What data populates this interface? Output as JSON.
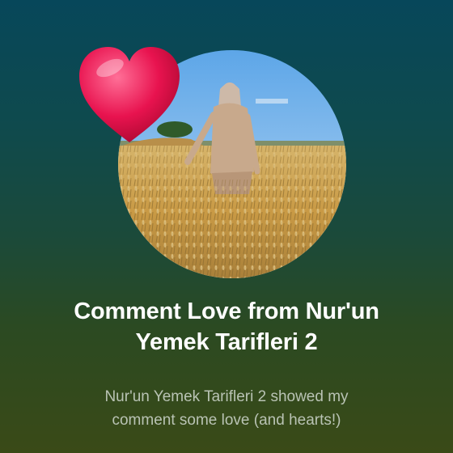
{
  "card": {
    "title_line1": "Comment Love from Nur'un",
    "title_line2": "Yemek Tarifleri 2",
    "subtitle_line1": "Nur'un Yemek Tarifleri 2 showed my",
    "subtitle_line2": "comment some love (and hearts!)"
  },
  "icons": {
    "heart": "heart-icon"
  },
  "colors": {
    "heart": "#e8134f",
    "title": "#ffffff",
    "subtitle": "#b9c3b4",
    "background_top": "#07475a",
    "background_bottom": "#3a4a17"
  }
}
